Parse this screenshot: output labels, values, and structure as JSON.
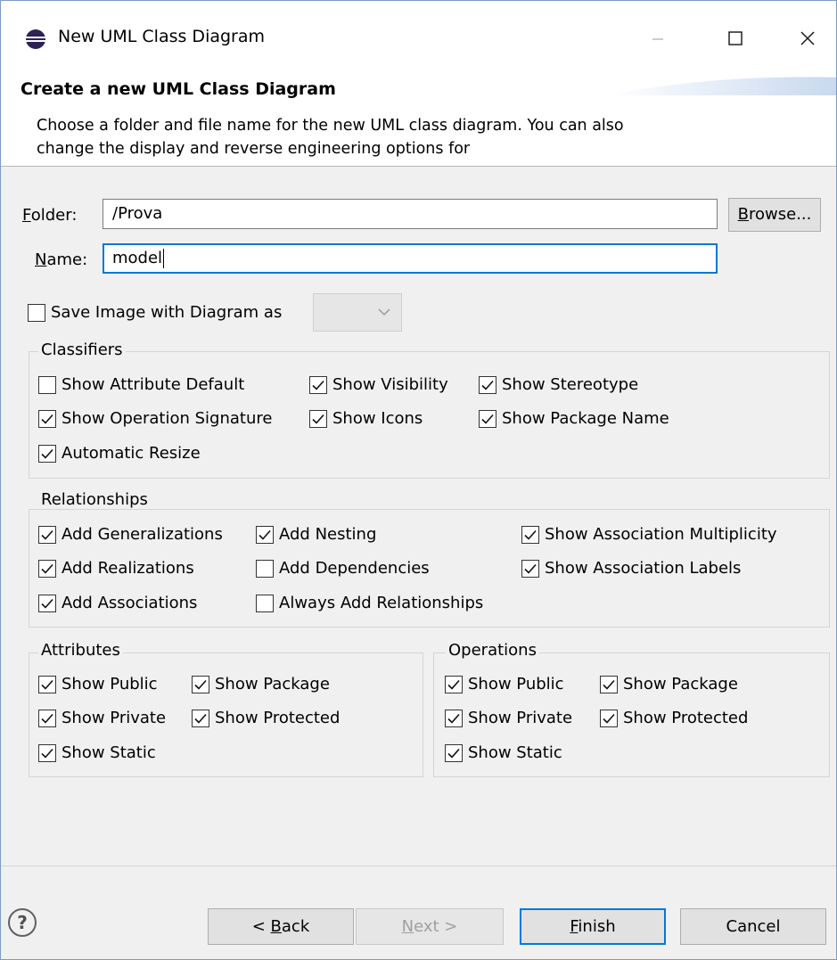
{
  "window": {
    "title": "New UML Class Diagram"
  },
  "banner": {
    "title": "Create a new UML Class Diagram",
    "description": "Choose a folder and file name for the new UML class diagram. You can also change the display and reverse engineering options for"
  },
  "form": {
    "folder_label_u": "F",
    "folder_label_rest": "older:",
    "folder_value": "/Prova",
    "browse_label_u": "B",
    "browse_label_rest": "rowse...",
    "name_label_u": "N",
    "name_label_rest": "ame:",
    "name_value": "model",
    "save_image_label": "Save Image with Diagram as",
    "save_image_checked": false,
    "image_format_value": ""
  },
  "classifiers": {
    "title": "Classifiers",
    "options": [
      {
        "label": "Show Attribute Default",
        "checked": false
      },
      {
        "label": "Show Visibility",
        "checked": true
      },
      {
        "label": "Show Stereotype",
        "checked": true
      },
      {
        "label": "Show Operation Signature",
        "checked": true
      },
      {
        "label": "Show Icons",
        "checked": true
      },
      {
        "label": "Show Package Name",
        "checked": true
      },
      {
        "label": "Automatic Resize",
        "checked": true
      }
    ]
  },
  "relationships": {
    "title": "Relationships",
    "options": [
      {
        "label": "Add Generalizations",
        "checked": true
      },
      {
        "label": "Add Nesting",
        "checked": true
      },
      {
        "label": "Show Association Multiplicity",
        "checked": true
      },
      {
        "label": "Add Realizations",
        "checked": true
      },
      {
        "label": "Add Dependencies",
        "checked": false
      },
      {
        "label": "Show Association Labels",
        "checked": true
      },
      {
        "label": "Add Associations",
        "checked": true
      },
      {
        "label": "Always Add Relationships",
        "checked": false
      }
    ]
  },
  "attributes": {
    "title": "Attributes",
    "options": [
      {
        "label": "Show Public",
        "checked": true
      },
      {
        "label": "Show Package",
        "checked": true
      },
      {
        "label": "Show Private",
        "checked": true
      },
      {
        "label": "Show Protected",
        "checked": true
      },
      {
        "label": "Show Static",
        "checked": true
      }
    ]
  },
  "operations": {
    "title": "Operations",
    "options": [
      {
        "label": "Show Public",
        "checked": true
      },
      {
        "label": "Show Package",
        "checked": true
      },
      {
        "label": "Show Private",
        "checked": true
      },
      {
        "label": "Show Protected",
        "checked": true
      },
      {
        "label": "Show Static",
        "checked": true
      }
    ]
  },
  "footer": {
    "help_symbol": "?",
    "back_prefix": "< ",
    "back_u": "B",
    "back_rest": "ack",
    "next_u": "N",
    "next_rest": "ext >",
    "finish_u": "F",
    "finish_rest": "inish",
    "cancel_label": "Cancel"
  },
  "colors": {
    "accent": "#0078d7",
    "window_bg": "#f0f0f0",
    "disabled_text": "#a0a0a0"
  },
  "icons": [
    "eclipse-app-icon",
    "minimize-icon",
    "maximize-icon",
    "close-icon",
    "chevron-down-icon",
    "checkmark-icon",
    "help-icon"
  ]
}
